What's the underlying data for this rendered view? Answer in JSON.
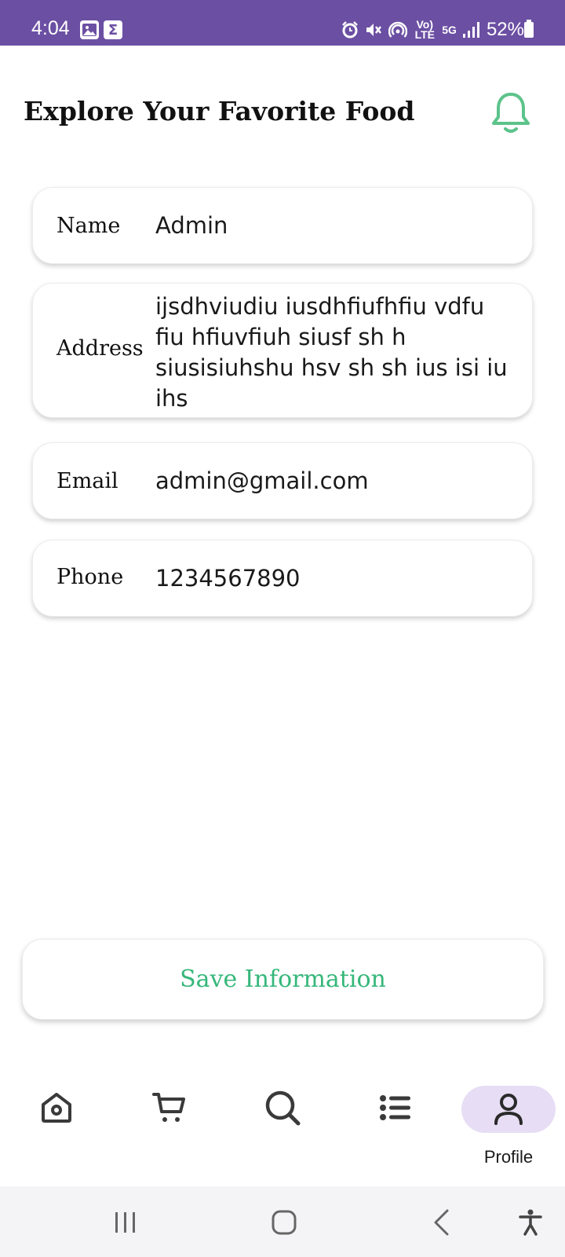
{
  "status_bar": {
    "time": "4:04",
    "left_icons": [
      "gallery-icon",
      "sigma-app-icon"
    ],
    "right_icons": [
      "alarm-icon",
      "mute-icon",
      "hotspot-icon",
      "volte-icon",
      "5g-icon",
      "signal-icon"
    ],
    "volte_label": "Vo) LTE",
    "network_label": "5G",
    "battery": "52%"
  },
  "header": {
    "title": "Explore Your Favorite Food",
    "bell_icon": "bell-icon",
    "accent_color": "#5cc38a"
  },
  "profile": {
    "name_label": "Name",
    "name_value": "Admin",
    "address_label": "Address",
    "address_value": "ijsdhviudiu iusdhfiufhfiu vdfu fiu hfiuvfiuh siusf sh h siusisiuhshu hsv  sh sh ius isi iu ihs",
    "email_label": "Email",
    "email_value": "admin@gmail.com",
    "phone_label": "Phone",
    "phone_value": "1234567890"
  },
  "save_button": {
    "label": "Save Information",
    "color": "#35b77a"
  },
  "bottom_nav": {
    "items": [
      {
        "icon": "home-icon"
      },
      {
        "icon": "cart-icon"
      },
      {
        "icon": "search-icon"
      },
      {
        "icon": "list-icon"
      },
      {
        "icon": "profile-icon",
        "label": "Profile",
        "active": true
      }
    ],
    "profile_label": "Profile",
    "active_bg": "#e7def5"
  },
  "system_nav": {
    "buttons": [
      "recents-icon",
      "home-circle-icon",
      "back-icon",
      "accessibility-icon"
    ]
  }
}
